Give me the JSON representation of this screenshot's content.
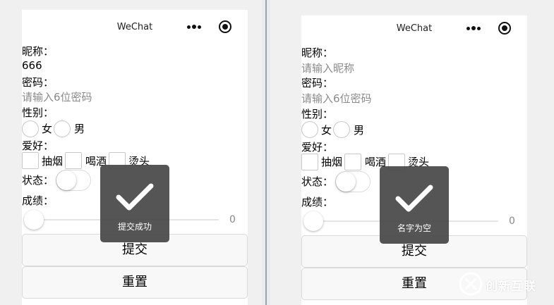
{
  "nav": {
    "title": "WeChat"
  },
  "left": {
    "nickname_label": "昵称：",
    "nickname_value": "666",
    "password_label": "密码：",
    "password_placeholder": "请输入6位密码",
    "gender_label": "性别：",
    "gender_options": [
      "女",
      "男"
    ],
    "hobby_label": "爱好：",
    "hobby_options": [
      "抽烟",
      "喝酒",
      "烫头"
    ],
    "status_label": "状态：",
    "score_label": "成绩：",
    "score_value": "0",
    "submit_label": "提交",
    "reset_label": "重置",
    "toast_text": "提交成功"
  },
  "right": {
    "nickname_label": "昵称：",
    "nickname_placeholder": "请输入昵称",
    "password_label": "密码：",
    "password_placeholder": "请输入6位密码",
    "gender_label": "性别：",
    "gender_options": [
      "女",
      "男"
    ],
    "hobby_label": "爱好：",
    "hobby_options": [
      "抽烟",
      "喝酒",
      "烫头"
    ],
    "status_label": "状态：",
    "score_label": "成绩：",
    "score_value": "0",
    "submit_label": "提交",
    "reset_label": "重置",
    "toast_text": "名字为空"
  },
  "watermark": {
    "text": "创新互联"
  },
  "icons": {
    "nav_menu": "more-dots-icon",
    "nav_close": "target-close-icon",
    "toast": "checkmark-icon",
    "watermark": "logo-x-icon"
  },
  "colors": {
    "toast_bg": "#4c4c4c",
    "placeholder": "#8a8a8a",
    "watermark": "#ffffff"
  },
  "state": {
    "switch_on": false,
    "slider_value": 0,
    "checkboxes_checked": [
      false,
      false,
      false
    ],
    "radio_selected": null
  }
}
